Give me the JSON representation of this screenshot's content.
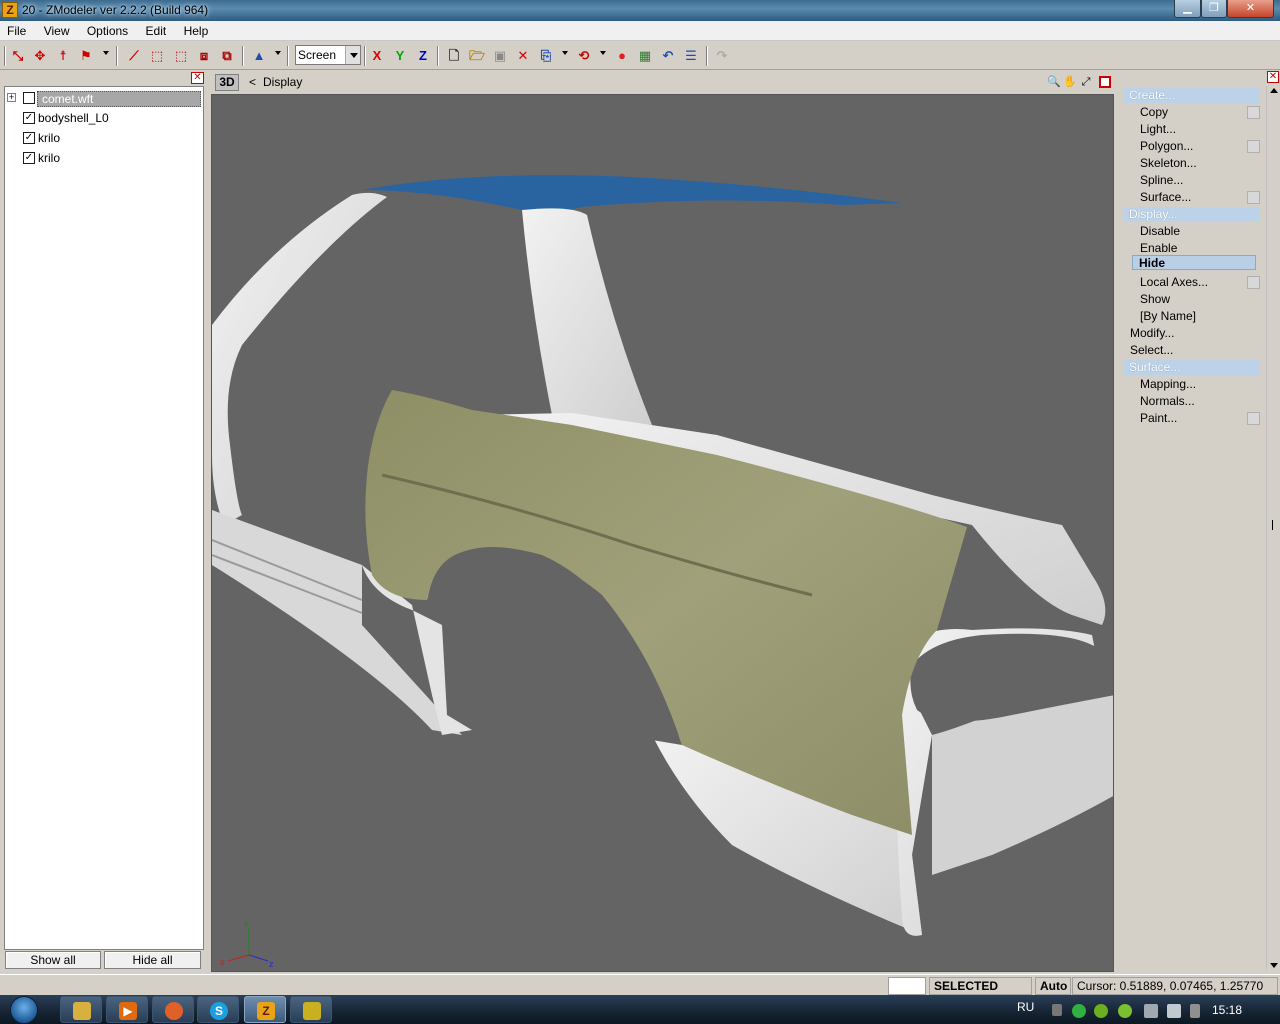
{
  "window": {
    "title": "20 - ZModeler ver 2.2.2 (Build 964)",
    "app_icon_letter": "Z"
  },
  "menu": {
    "file": "File",
    "view": "View",
    "options": "Options",
    "edit": "Edit",
    "help": "Help"
  },
  "toolbar": {
    "coord_mode": "Screen",
    "axis_x": "X",
    "axis_y": "Y",
    "axis_z": "Z"
  },
  "tree": {
    "items": [
      {
        "label": "comet.wft",
        "checked": false,
        "selected": true
      },
      {
        "label": "bodyshell_L0",
        "checked": true
      },
      {
        "label": "krilo",
        "checked": true
      },
      {
        "label": "krilo",
        "checked": true
      }
    ],
    "show_all": "Show all",
    "hide_all": "Hide all",
    "expander": "+",
    "check_mark": "✓"
  },
  "viewport": {
    "mode": "3D",
    "back": "<",
    "breadcrumb": "Display",
    "axis_x": "x",
    "axis_y": "y",
    "axis_z": "z"
  },
  "commands": {
    "create_header": "Create...",
    "create_items": [
      "Copy",
      "Light...",
      "Polygon...",
      "Skeleton...",
      "Spline...",
      "Surface..."
    ],
    "display_header": "Display...",
    "display_items": [
      "Disable",
      "Enable"
    ],
    "display_active": "Hide",
    "display_items2": [
      "Local Axes...",
      "Show",
      "[By Name]"
    ],
    "modify": "Modify...",
    "select": "Select...",
    "surface_header": "Surface...",
    "surface_items": [
      "Mapping...",
      "Normals...",
      "Paint..."
    ]
  },
  "status": {
    "mode": "SELECTED MODE",
    "auto": "Auto",
    "cursor": "Cursor: 0.51889, 0.07465, 1.25770"
  },
  "taskbar": {
    "lang": "RU",
    "time": "15:18"
  },
  "colors": {
    "viewport_bg": "#646464",
    "fender": "#9a9a72",
    "body_white": "#e6e6e6",
    "roof_blue": "#2a64a0"
  }
}
